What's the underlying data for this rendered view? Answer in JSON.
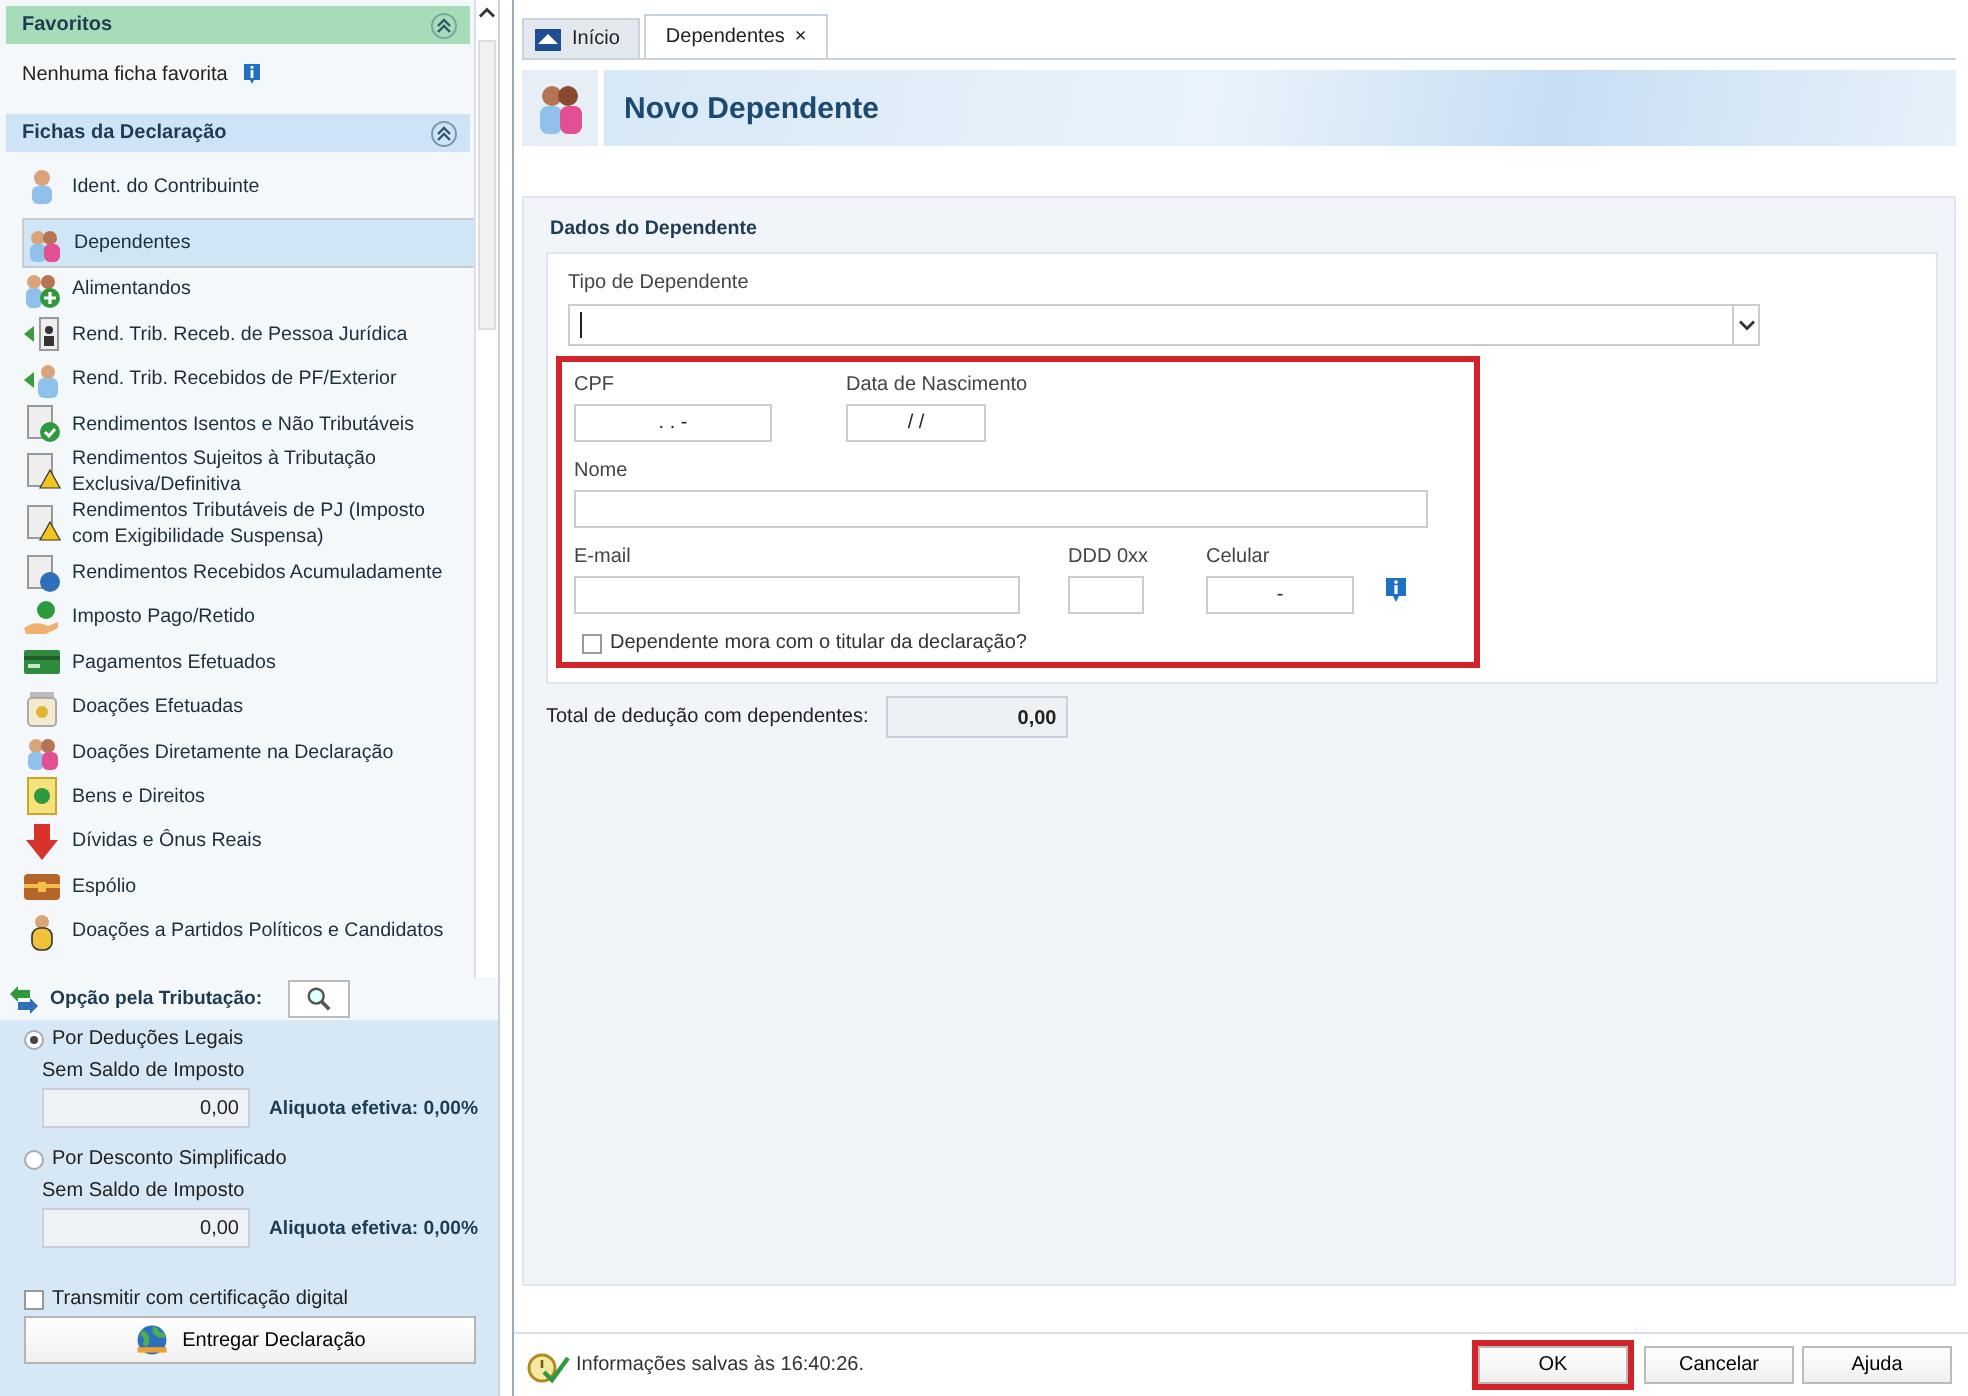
{
  "sidebar": {
    "favorites": {
      "title": "Favoritos",
      "expanded": true,
      "empty_text": "Nenhuma ficha favorita"
    },
    "fichas": {
      "title": "Fichas da Declaração",
      "expanded": true,
      "items": [
        {
          "label": "Ident. do Contribuinte",
          "selected": false
        },
        {
          "label": "Dependentes",
          "selected": true
        },
        {
          "label": "Alimentandos",
          "selected": false
        },
        {
          "label": "Rend. Trib. Receb. de Pessoa Jurídica",
          "selected": false
        },
        {
          "label": "Rend. Trib. Recebidos de PF/Exterior",
          "selected": false
        },
        {
          "label": "Rendimentos Isentos e Não Tributáveis",
          "selected": false
        },
        {
          "label": "Rendimentos Sujeitos à Tributação Exclusiva/Definitiva",
          "selected": false
        },
        {
          "label": "Rendimentos Tributáveis de PJ (Imposto com Exigibilidade Suspensa)",
          "selected": false
        },
        {
          "label": "Rendimentos Recebidos Acumuladamente",
          "selected": false
        },
        {
          "label": "Imposto Pago/Retido",
          "selected": false
        },
        {
          "label": "Pagamentos Efetuados",
          "selected": false
        },
        {
          "label": "Doações Efetuadas",
          "selected": false
        },
        {
          "label": "Doações Diretamente na Declaração",
          "selected": false
        },
        {
          "label": "Bens e Direitos",
          "selected": false
        },
        {
          "label": "Dívidas e Ônus Reais",
          "selected": false
        },
        {
          "label": "Espólio",
          "selected": false
        },
        {
          "label": "Doações a Partidos Políticos e Candidatos",
          "selected": false
        }
      ]
    },
    "tributacao": {
      "title": "Opção pela Tributação:",
      "options": [
        {
          "label": "Por Deduções Legais",
          "selected": true,
          "sublabel": "Sem Saldo de Imposto",
          "value": "0,00",
          "rate": "Aliquota efetiva: 0,00%"
        },
        {
          "label": "Por Desconto Simplificado",
          "selected": false,
          "sublabel": "Sem Saldo de Imposto",
          "value": "0,00",
          "rate": "Aliquota efetiva: 0,00%"
        }
      ],
      "digital_cert": {
        "label": "Transmitir com certificação digital",
        "checked": false
      },
      "submit_button": "Entregar Declaração"
    }
  },
  "tabs": [
    {
      "label": "Início",
      "selected": false
    },
    {
      "label": "Dependentes",
      "selected": true,
      "close": "×"
    }
  ],
  "header": {
    "title": "Novo Dependente"
  },
  "form": {
    "section_title": "Dados do Dependente",
    "tipo_label": "Tipo de Dependente",
    "highlighted": true,
    "cpf": {
      "label": "CPF",
      "value": ". . -"
    },
    "nascimento": {
      "label": "Data de Nascimento",
      "value": "/ /"
    },
    "nome": {
      "label": "Nome"
    },
    "email": {
      "label": "E-mail"
    },
    "ddd": {
      "label": "DDD 0xx"
    },
    "celular": {
      "label": "Celular",
      "value": "-"
    },
    "mora": {
      "label": "Dependente mora com o titular da declaração?",
      "checked": false
    }
  },
  "total": {
    "label": "Total de dedução com dependentes:",
    "value": "0,00"
  },
  "status_bar": {
    "text": "Informações salvas às 16:40:26."
  },
  "buttons": [
    {
      "label": "OK",
      "highlighted": true
    },
    {
      "label": "Cancelar",
      "highlighted": false
    },
    {
      "label": "Ajuda",
      "highlighted": false
    }
  ]
}
